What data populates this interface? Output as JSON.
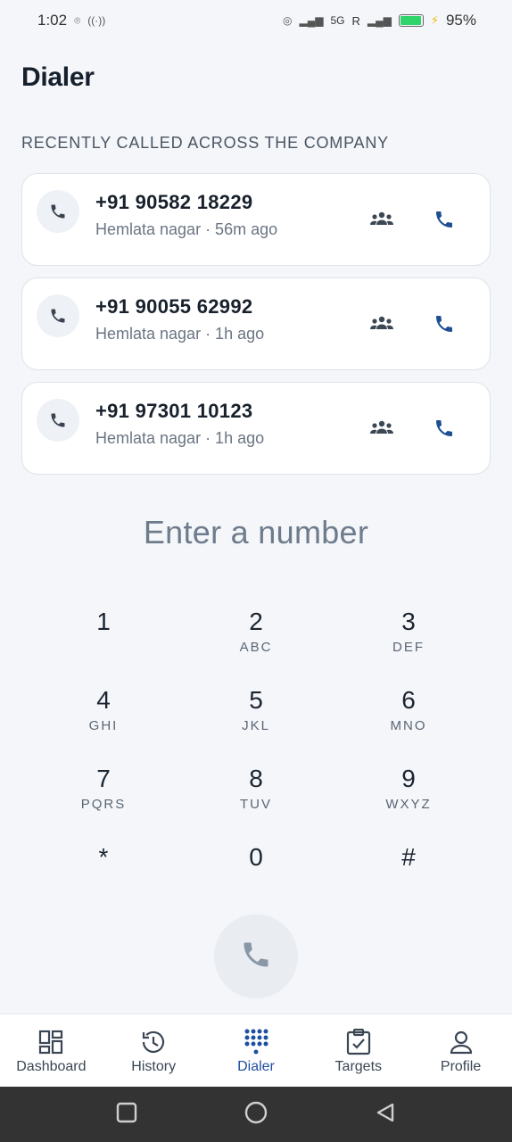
{
  "status_bar": {
    "time": "1:02",
    "network": "5G",
    "roaming": "R",
    "battery": "95%",
    "battery_level": 0.95
  },
  "header": {
    "title": "Dialer"
  },
  "recent": {
    "section_label": "RECENTLY CALLED ACROSS THE COMPANY",
    "items": [
      {
        "number": "+91 90582 18229",
        "meta": "Hemlata nagar · 56m ago"
      },
      {
        "number": "+91 90055 62992",
        "meta": "Hemlata nagar · 1h ago"
      },
      {
        "number": "+91 97301 10123",
        "meta": "Hemlata nagar · 1h ago"
      }
    ]
  },
  "dialer": {
    "placeholder": "Enter a number",
    "keys": [
      {
        "digit": "1",
        "letters": ""
      },
      {
        "digit": "2",
        "letters": "ABC"
      },
      {
        "digit": "3",
        "letters": "DEF"
      },
      {
        "digit": "4",
        "letters": "GHI"
      },
      {
        "digit": "5",
        "letters": "JKL"
      },
      {
        "digit": "6",
        "letters": "MNO"
      },
      {
        "digit": "7",
        "letters": "PQRS"
      },
      {
        "digit": "8",
        "letters": "TUV"
      },
      {
        "digit": "9",
        "letters": "WXYZ"
      },
      {
        "digit": "*",
        "letters": ""
      },
      {
        "digit": "0",
        "letters": ""
      },
      {
        "digit": "#",
        "letters": ""
      }
    ]
  },
  "bottom_nav": {
    "items": [
      {
        "label": "Dashboard",
        "icon": "dashboard-icon"
      },
      {
        "label": "History",
        "icon": "history-icon"
      },
      {
        "label": "Dialer",
        "icon": "dialpad-icon",
        "active": true
      },
      {
        "label": "Targets",
        "icon": "clipboard-check-icon"
      },
      {
        "label": "Profile",
        "icon": "user-icon"
      }
    ]
  },
  "colors": {
    "accent": "#1e4fa0",
    "call_icon": "#1d4f91",
    "background": "#f4f6f9",
    "system_nav": "#333333"
  }
}
